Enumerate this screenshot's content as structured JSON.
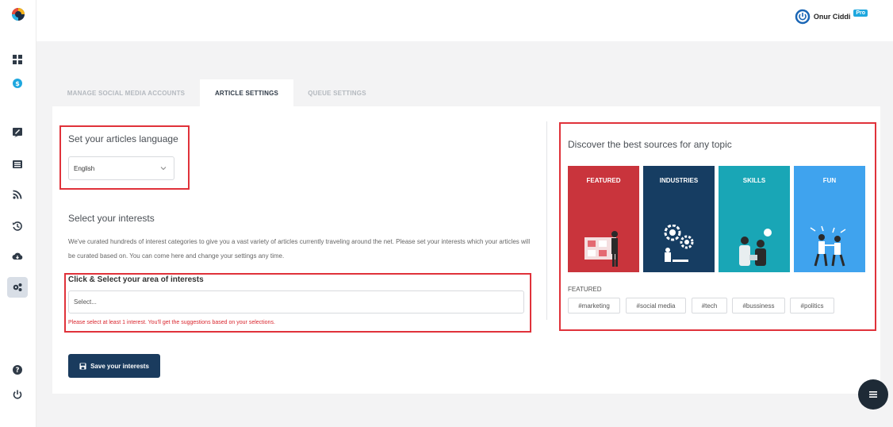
{
  "header": {
    "user_name": "Onur Ciddi",
    "badge": "Pro"
  },
  "tabs": [
    {
      "label": "MANAGE SOCIAL MEDIA ACCOUNTS",
      "active": false
    },
    {
      "label": "ARTICLE SETTINGS",
      "active": true
    },
    {
      "label": "QUEUE SETTINGS",
      "active": false
    }
  ],
  "sidebar": {
    "icons": [
      "dashboard-icon",
      "dollar-icon",
      "compose-icon",
      "list-icon",
      "rss-icon",
      "history-icon",
      "cloud-download-icon",
      "settings-icon",
      "help-icon",
      "power-icon"
    ],
    "active": "settings-icon"
  },
  "language": {
    "title": "Set your articles language",
    "selected": "English"
  },
  "interests": {
    "title": "Select your interests",
    "description": "We've curated hundreds of interest categories to give you a vast variety of articles currently traveling around the net. Please set your interests which your articles will be curated based on. You can come here and change your settings any time.",
    "area_label": "Click & Select your area of interests",
    "placeholder": "Select...",
    "error": "Please select at least 1 interest. You'll get the suggestions based on your selections.",
    "save_label": "Save your interests"
  },
  "discover": {
    "title": "Discover the best sources for any topic",
    "tiles": [
      {
        "label": "FEATURED",
        "color": "#c9343c"
      },
      {
        "label": "INDUSTRIES",
        "color": "#163d62"
      },
      {
        "label": "SKILLS",
        "color": "#19a6b6"
      },
      {
        "label": "FUN",
        "color": "#3fa3ee"
      }
    ],
    "section_label": "FEATURED",
    "tags": [
      "#marketing",
      "#social media",
      "#tech",
      "#bussiness",
      "#politics"
    ]
  },
  "colors": {
    "accent": "#1a3b5e",
    "highlight": "#e0323a",
    "error": "#d9262e"
  }
}
